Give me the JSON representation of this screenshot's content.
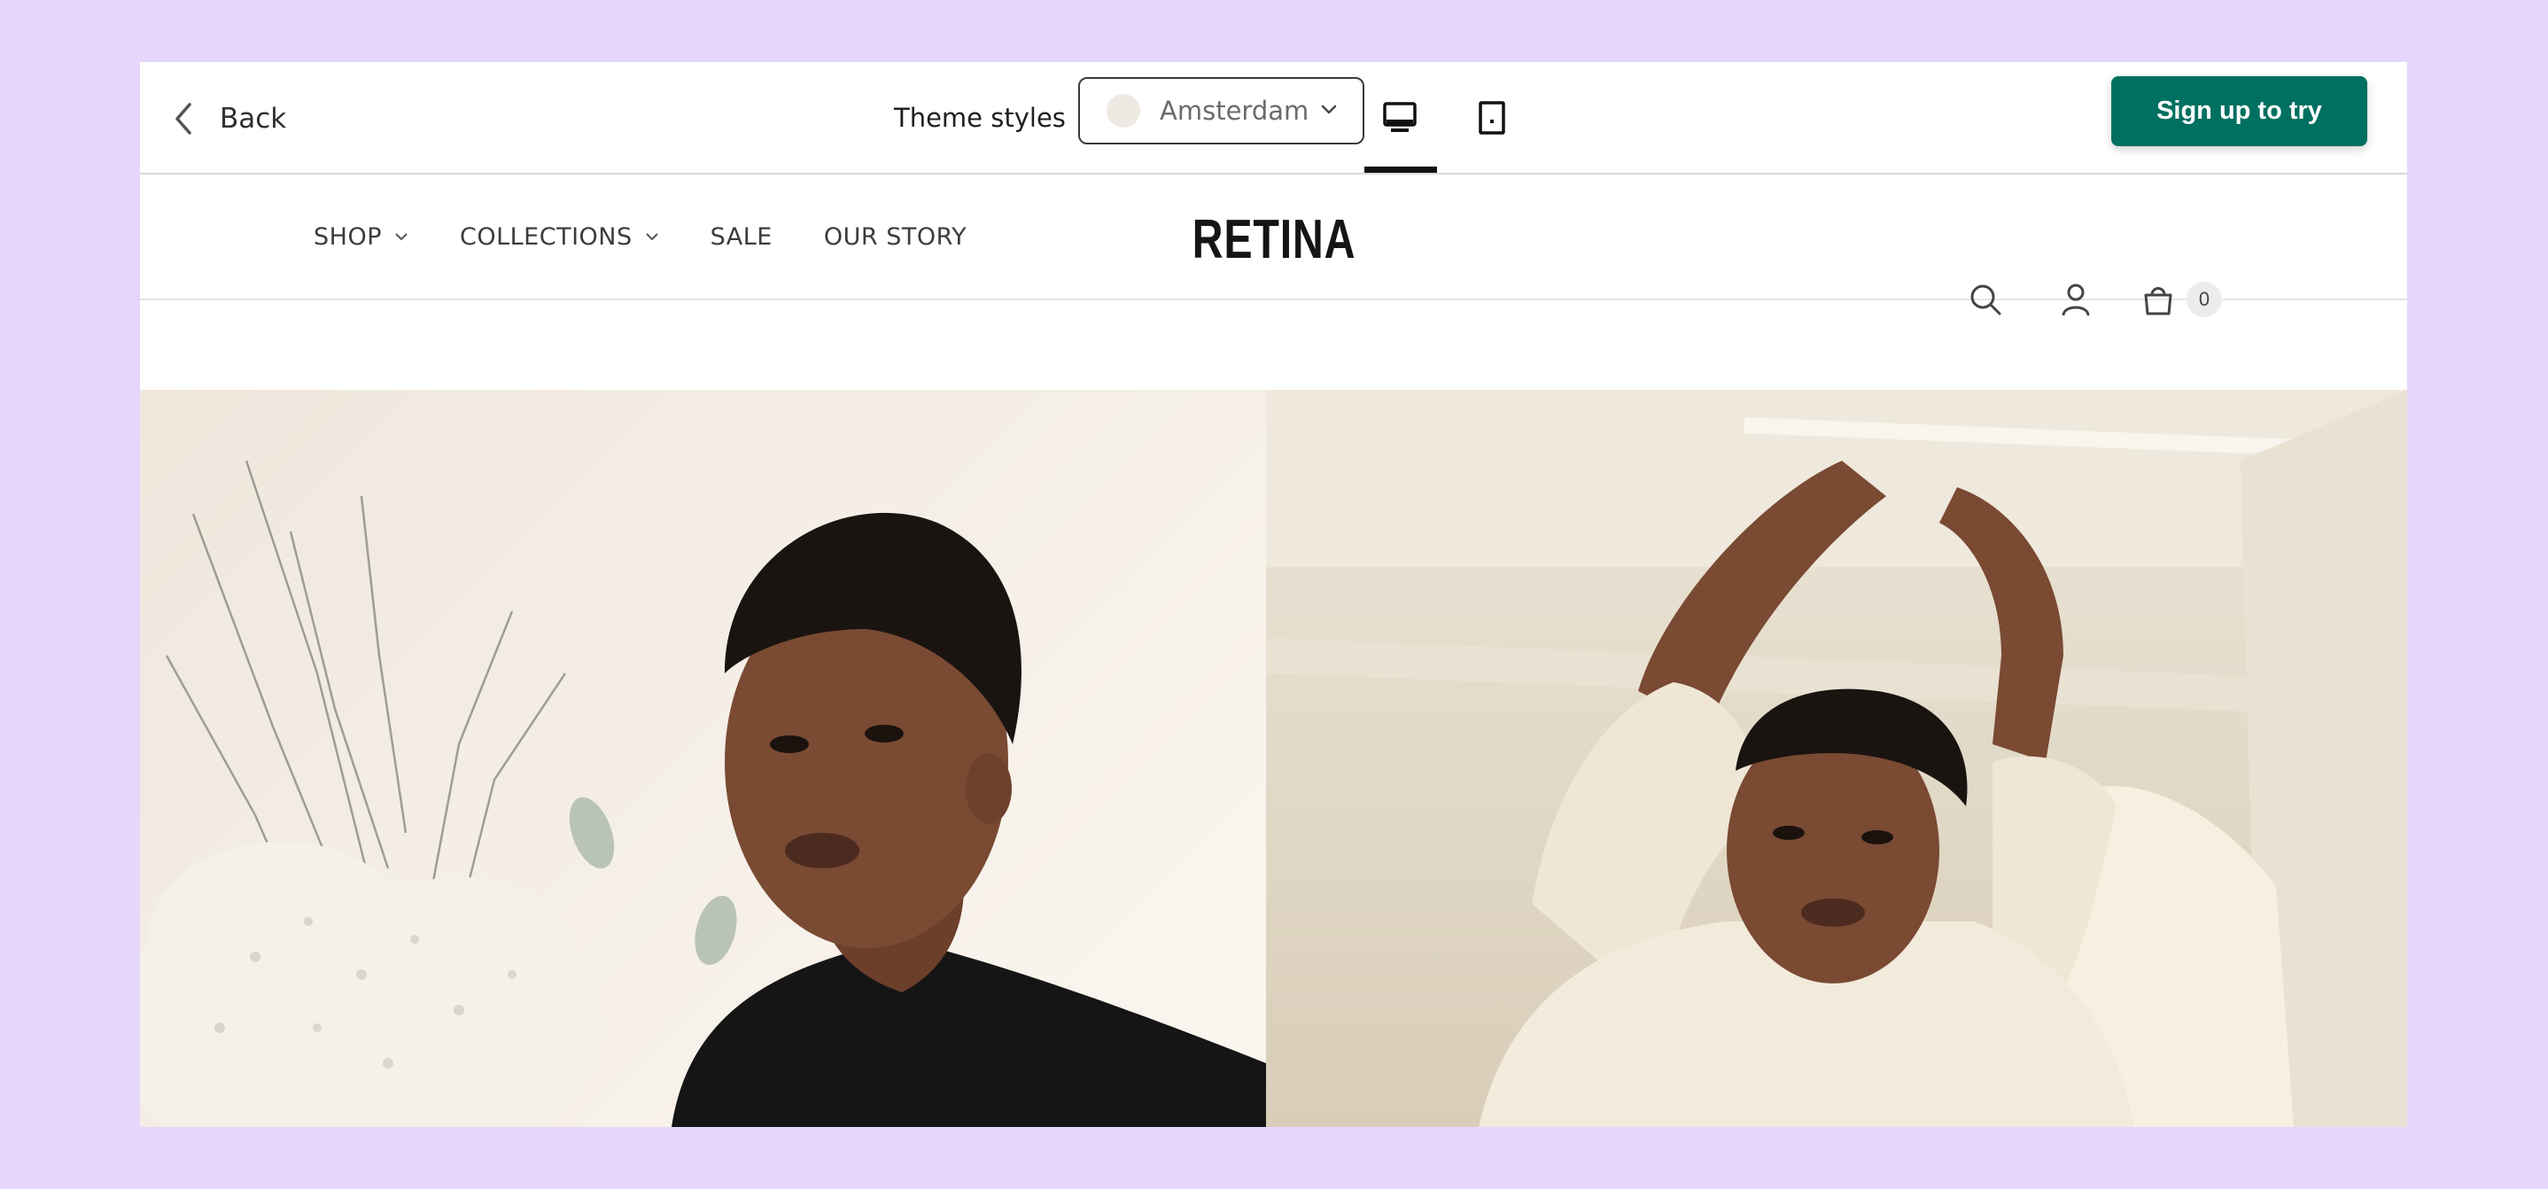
{
  "toolbar": {
    "back_label": "Back",
    "theme_label": "Theme styles",
    "theme_value": "Amsterdam",
    "signup_label": "Sign up to try",
    "active_view": "desktop"
  },
  "store": {
    "logo": "RETINA",
    "nav": [
      {
        "label": "SHOP",
        "has_dropdown": true
      },
      {
        "label": "COLLECTIONS",
        "has_dropdown": true
      },
      {
        "label": "SALE",
        "has_dropdown": false
      },
      {
        "label": "OUR STORY",
        "has_dropdown": false
      }
    ],
    "cart_count": "0",
    "icons": [
      "search-icon",
      "account-icon",
      "cart-icon"
    ]
  },
  "colors": {
    "page_background": "#e6d6fb",
    "accent": "#007060"
  }
}
